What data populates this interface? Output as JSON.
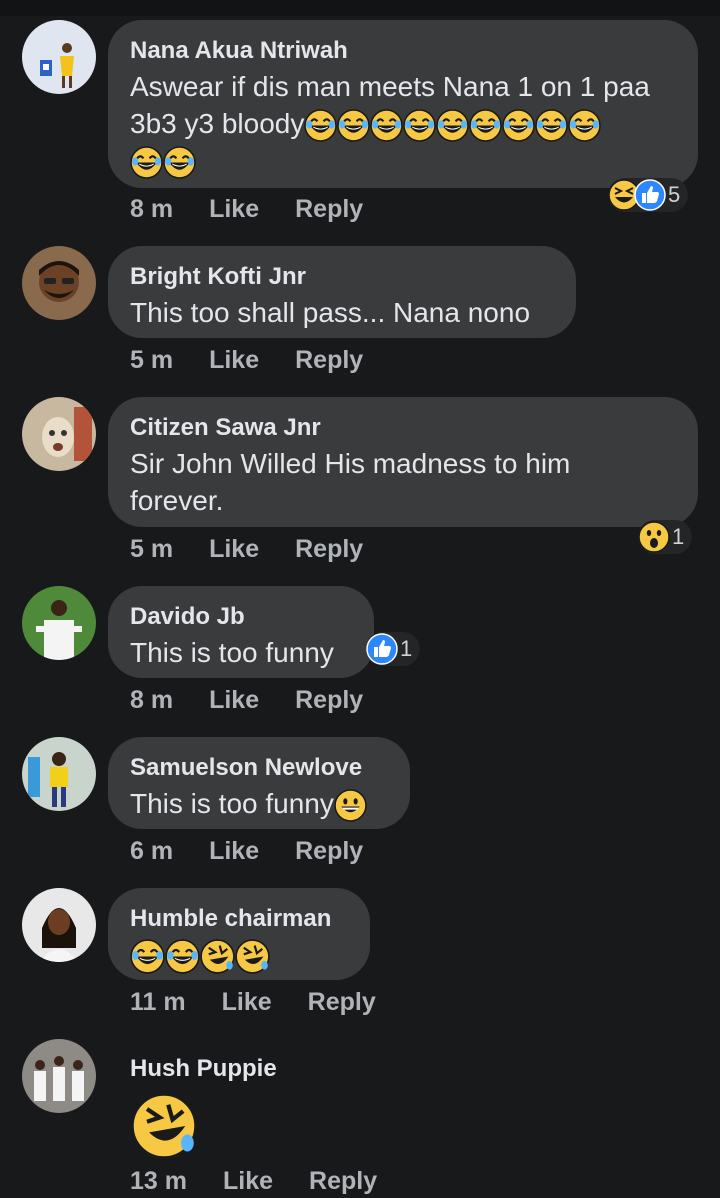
{
  "comments": [
    {
      "author": "Nana Akua Ntriwah",
      "text": "Aswear if dis man meets Nana 1 on 1 paa\n3b3 y3 bloody",
      "time": "8 m",
      "like": "Like",
      "reply": "Reply",
      "reaction_count": "5",
      "emojis": "😂😂😂😂😂😂😂😂😂😂😂"
    },
    {
      "author": "Bright Kofti Jnr",
      "text": "This too shall pass... Nana nono",
      "time": "5 m",
      "like": "Like",
      "reply": "Reply"
    },
    {
      "author": "Citizen Sawa Jnr",
      "text": "Sir John Willed His madness to him\nforever.",
      "time": "5 m",
      "like": "Like",
      "reply": "Reply",
      "reaction_count": "1"
    },
    {
      "author": "Davido Jb",
      "text": "This is too funny",
      "time": "8 m",
      "like": "Like",
      "reply": "Reply",
      "reaction_count": "1"
    },
    {
      "author": "Samuelson Newlove",
      "text": "This is too funny",
      "time": "6 m",
      "like": "Like",
      "reply": "Reply",
      "emojis": "😀"
    },
    {
      "author": "Humble chairman",
      "text": "",
      "time": "11 m",
      "like": "Like",
      "reply": "Reply",
      "emojis": "😂😂🤣🤣"
    },
    {
      "author": "Hush Puppie",
      "text": "",
      "time": "13 m",
      "like": "Like",
      "reply": "Reply",
      "emojis": "🤣"
    }
  ],
  "colors": {
    "background": "#18191a",
    "bubble": "#3a3b3c",
    "text": "#e4e6eb",
    "meta": "#b0b3b8",
    "like_blue": "#2d88ff",
    "emoji_yellow": "#f7c843"
  }
}
